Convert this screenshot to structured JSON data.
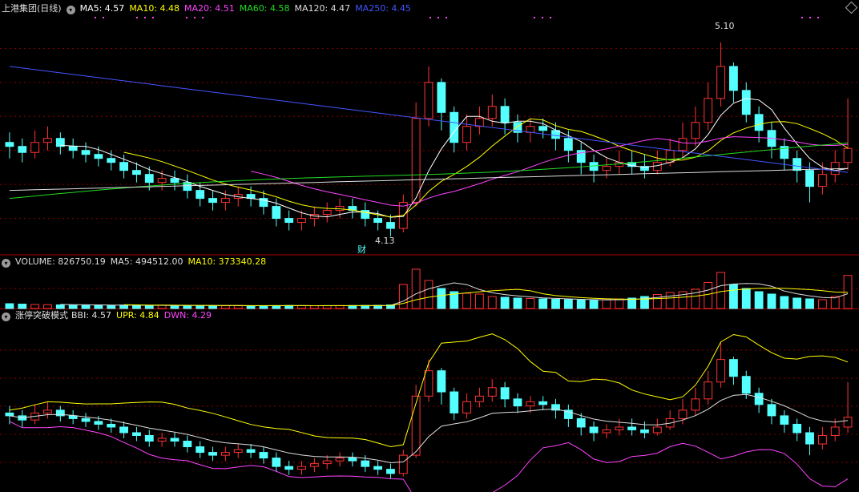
{
  "panel1": {
    "title": "上港集团(日线)",
    "indicators": [
      {
        "label": "MA5: 4.57",
        "color": "#ffffff"
      },
      {
        "label": "MA10: 4.48",
        "color": "#ffff00"
      },
      {
        "label": "MA20: 4.51",
        "color": "#ff44ff"
      },
      {
        "label": "MA60: 4.58",
        "color": "#22dd22"
      },
      {
        "label": "MA120: 4.47",
        "color": "#dddddd"
      },
      {
        "label": "MA250: 4.45",
        "color": "#4455ff"
      }
    ],
    "high_label": "5.10",
    "low_label": "4.13",
    "marker_label": "财"
  },
  "panel2": {
    "indicators": [
      {
        "label": "VOLUME: 826750.19",
        "color": "#dddddd"
      },
      {
        "label": "MA5: 494512.00",
        "color": "#dddddd"
      },
      {
        "label": "MA10: 373340.28",
        "color": "#ffff00"
      }
    ]
  },
  "panel3": {
    "title": "涨停突破模式",
    "indicators": [
      {
        "label": "BBI: 4.57",
        "color": "#dddddd"
      },
      {
        "label": "UPR: 4.84",
        "color": "#ffff00"
      },
      {
        "label": "DWN: 4.29",
        "color": "#ff44ff"
      }
    ]
  },
  "colors": {
    "up": "#ff3333",
    "down": "#54ffff",
    "grid": "#8b0000",
    "divider": "#b00000"
  },
  "chart_data": [
    {
      "type": "candlestick",
      "title": "上港集团(日线)",
      "ylim": [
        4.05,
        5.2
      ],
      "high": 5.1,
      "low": 4.13,
      "ohlc": [
        [
          4.6,
          4.58,
          4.65,
          4.52
        ],
        [
          4.58,
          4.55,
          4.62,
          4.5
        ],
        [
          4.55,
          4.6,
          4.66,
          4.52
        ],
        [
          4.6,
          4.62,
          4.68,
          4.56
        ],
        [
          4.62,
          4.58,
          4.65,
          4.54
        ],
        [
          4.58,
          4.56,
          4.62,
          4.52
        ],
        [
          4.56,
          4.54,
          4.6,
          4.5
        ],
        [
          4.54,
          4.52,
          4.58,
          4.48
        ],
        [
          4.52,
          4.5,
          4.56,
          4.46
        ],
        [
          4.5,
          4.46,
          4.54,
          4.42
        ],
        [
          4.46,
          4.44,
          4.5,
          4.4
        ],
        [
          4.44,
          4.4,
          4.48,
          4.36
        ],
        [
          4.4,
          4.42,
          4.46,
          4.36
        ],
        [
          4.42,
          4.4,
          4.46,
          4.36
        ],
        [
          4.4,
          4.36,
          4.44,
          4.32
        ],
        [
          4.36,
          4.32,
          4.4,
          4.28
        ],
        [
          4.32,
          4.3,
          4.36,
          4.26
        ],
        [
          4.3,
          4.32,
          4.36,
          4.26
        ],
        [
          4.32,
          4.34,
          4.38,
          4.28
        ],
        [
          4.34,
          4.32,
          4.38,
          4.28
        ],
        [
          4.32,
          4.28,
          4.36,
          4.24
        ],
        [
          4.28,
          4.22,
          4.32,
          4.18
        ],
        [
          4.22,
          4.2,
          4.26,
          4.16
        ],
        [
          4.2,
          4.22,
          4.26,
          4.16
        ],
        [
          4.22,
          4.24,
          4.28,
          4.18
        ],
        [
          4.24,
          4.26,
          4.3,
          4.2
        ],
        [
          4.26,
          4.28,
          4.32,
          4.22
        ],
        [
          4.28,
          4.26,
          4.32,
          4.22
        ],
        [
          4.26,
          4.22,
          4.3,
          4.18
        ],
        [
          4.22,
          4.2,
          4.26,
          4.16
        ],
        [
          4.2,
          4.17,
          4.24,
          4.13
        ],
        [
          4.17,
          4.3,
          4.34,
          4.15
        ],
        [
          4.3,
          4.72,
          4.8,
          4.28
        ],
        [
          4.72,
          4.9,
          4.98,
          4.68
        ],
        [
          4.9,
          4.75,
          4.92,
          4.66
        ],
        [
          4.75,
          4.6,
          4.78,
          4.55
        ],
        [
          4.6,
          4.68,
          4.74,
          4.56
        ],
        [
          4.68,
          4.72,
          4.78,
          4.64
        ],
        [
          4.72,
          4.78,
          4.84,
          4.68
        ],
        [
          4.78,
          4.7,
          4.82,
          4.64
        ],
        [
          4.7,
          4.65,
          4.74,
          4.6
        ],
        [
          4.65,
          4.68,
          4.72,
          4.6
        ],
        [
          4.68,
          4.66,
          4.72,
          4.62
        ],
        [
          4.66,
          4.62,
          4.7,
          4.56
        ],
        [
          4.62,
          4.56,
          4.66,
          4.5
        ],
        [
          4.56,
          4.5,
          4.6,
          4.44
        ],
        [
          4.5,
          4.46,
          4.54,
          4.4
        ],
        [
          4.46,
          4.48,
          4.52,
          4.42
        ],
        [
          4.48,
          4.5,
          4.56,
          4.44
        ],
        [
          4.5,
          4.48,
          4.56,
          4.44
        ],
        [
          4.48,
          4.46,
          4.54,
          4.42
        ],
        [
          4.46,
          4.5,
          4.56,
          4.44
        ],
        [
          4.5,
          4.56,
          4.62,
          4.48
        ],
        [
          4.56,
          4.62,
          4.7,
          4.52
        ],
        [
          4.62,
          4.7,
          4.78,
          4.58
        ],
        [
          4.7,
          4.82,
          4.9,
          4.66
        ],
        [
          4.82,
          4.98,
          5.1,
          4.78
        ],
        [
          4.98,
          4.86,
          5.0,
          4.8
        ],
        [
          4.86,
          4.74,
          4.9,
          4.7
        ],
        [
          4.74,
          4.66,
          4.78,
          4.6
        ],
        [
          4.66,
          4.58,
          4.7,
          4.52
        ],
        [
          4.58,
          4.52,
          4.62,
          4.46
        ],
        [
          4.52,
          4.46,
          4.56,
          4.4
        ],
        [
          4.46,
          4.38,
          4.5,
          4.3
        ],
        [
          4.38,
          4.44,
          4.5,
          4.34
        ],
        [
          4.44,
          4.5,
          4.56,
          4.4
        ],
        [
          4.5,
          4.57,
          4.82,
          4.46
        ]
      ]
    },
    {
      "type": "bar",
      "title": "VOLUME",
      "ylim": [
        0,
        1000000
      ],
      "series": [
        {
          "name": "VOLUME",
          "values": [
            120000,
            110000,
            100000,
            95000,
            90000,
            88000,
            85000,
            90000,
            80000,
            85000,
            70000,
            75000,
            80000,
            70000,
            75000,
            72000,
            70000,
            68000,
            72000,
            70000,
            68000,
            72000,
            75000,
            70000,
            68000,
            70000,
            72000,
            74000,
            76000,
            80000,
            90000,
            600000,
            980000,
            700000,
            500000,
            420000,
            380000,
            360000,
            300000,
            280000,
            260000,
            250000,
            240000,
            230000,
            220000,
            210000,
            200000,
            220000,
            240000,
            260000,
            300000,
            350000,
            400000,
            420000,
            480000,
            650000,
            900000,
            600000,
            500000,
            420000,
            360000,
            300000,
            260000,
            240000,
            220000,
            300000,
            826750
          ]
        }
      ],
      "last": 826750.19,
      "ma5": 494512.0,
      "ma10": 373340.28
    },
    {
      "type": "line",
      "title": "涨停突破模式",
      "series": [
        {
          "name": "BBI",
          "last": 4.57
        },
        {
          "name": "UPR",
          "last": 4.84
        },
        {
          "name": "DWN",
          "last": 4.29
        }
      ]
    }
  ]
}
